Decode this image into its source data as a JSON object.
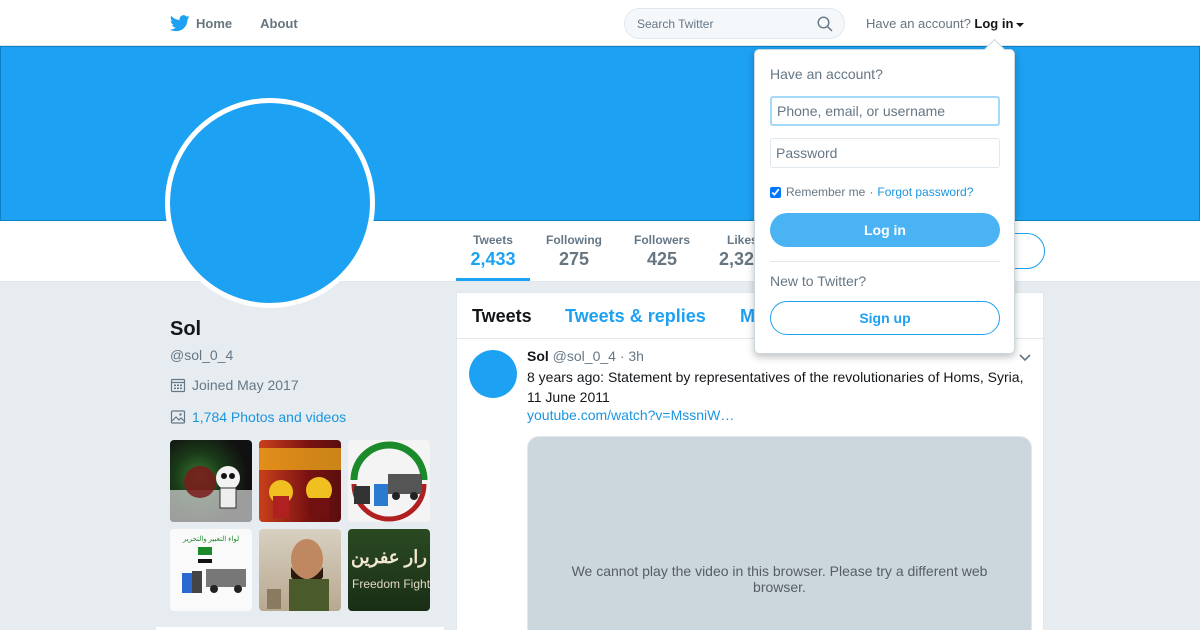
{
  "topbar": {
    "home_label": "Home",
    "about_label": "About",
    "search_placeholder": "Search Twitter",
    "have_account_text": "Have an account?",
    "login_label": "Log in"
  },
  "profile": {
    "name": "Sol",
    "handle": "@sol_0_4",
    "joined": "Joined May 2017",
    "photos_label": "1,784 Photos and videos"
  },
  "stats": [
    {
      "label": "Tweets",
      "value": "2,433"
    },
    {
      "label": "Following",
      "value": "275"
    },
    {
      "label": "Followers",
      "value": "425"
    },
    {
      "label": "Likes",
      "value": "2,32"
    }
  ],
  "timeline": {
    "tabs": [
      "Tweets",
      "Tweets & replies",
      "M"
    ]
  },
  "tweet": {
    "name": "Sol",
    "handle": "@sol_0_4",
    "time": "· 3h",
    "text": "8 years ago: Statement by representatives of the revolutionaries of Homs, Syria, 11 June 2011",
    "link": "youtube.com/watch?v=MssniW…",
    "video_message": "We cannot play the video in this browser. Please try a different web browser."
  },
  "thumbnails": {
    "t5_caption": "لواء التعبير والتحرير",
    "t6_caption_ar": "رار عفرين",
    "t6_caption_en": "Freedom Fighte"
  },
  "login_dropdown": {
    "title": "Have an account?",
    "username_placeholder": "Phone, email, or username",
    "password_placeholder": "Password",
    "remember_me": "Remember me",
    "separator": "·",
    "forgot_password": "Forgot password?",
    "login_button": "Log in",
    "new_to_twitter": "New to Twitter?",
    "signup_button": "Sign up"
  },
  "colors": {
    "brand": "#1da1f2",
    "link": "#1b95e0",
    "background": "#e6ecf0"
  }
}
